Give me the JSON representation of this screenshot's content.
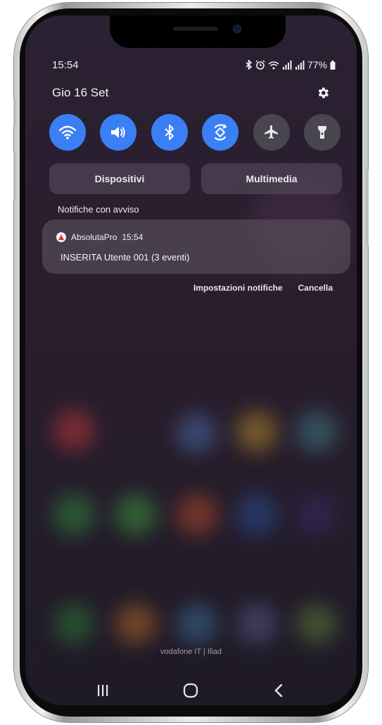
{
  "status_bar": {
    "time": "15:54",
    "battery": "77%"
  },
  "header": {
    "date": "Gio 16 Set"
  },
  "quick_toggles": [
    {
      "name": "wifi",
      "icon": "wifi-icon",
      "active": true
    },
    {
      "name": "sound",
      "icon": "volume-icon",
      "active": true
    },
    {
      "name": "bluetooth",
      "icon": "bluetooth-icon",
      "active": true
    },
    {
      "name": "auto-rotate",
      "icon": "auto-rotate-icon",
      "active": true
    },
    {
      "name": "airplane",
      "icon": "airplane-icon",
      "active": false
    },
    {
      "name": "flashlight",
      "icon": "flashlight-icon",
      "active": false
    }
  ],
  "pills": {
    "devices": "Dispositivi",
    "media": "Multimedia"
  },
  "section": {
    "alert_label": "Notifiche con avviso"
  },
  "notification": {
    "app": "AbsolutaPro",
    "time": "15:54",
    "message": "INSERITA Utente 001 (3 eventi)"
  },
  "notification_actions": {
    "settings": "Impostazioni notifiche",
    "clear": "Cancella"
  },
  "carrier": "vodafone IT | Iliad",
  "colors": {
    "toggle_on": "#3a7ff4",
    "toggle_off": "#4a4650"
  }
}
